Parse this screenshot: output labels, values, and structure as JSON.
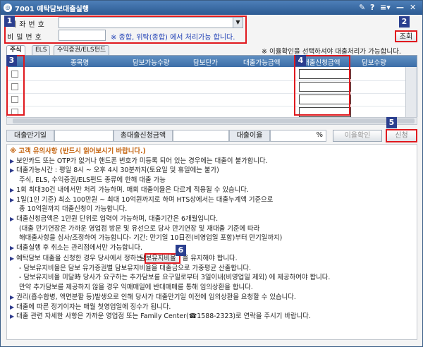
{
  "window": {
    "title": "7001 예탁담보대출실행",
    "controls": [
      "✎",
      "?",
      "≡▾",
      "—",
      "✕"
    ]
  },
  "annotations": [
    "1",
    "2",
    "3",
    "4",
    "5",
    "6"
  ],
  "form": {
    "account_label": "계좌번호",
    "password_label": "비밀번호",
    "password_note": "※ 종합, 위탁(종합) 에서 처리가능 합니다.",
    "query_button": "조회"
  },
  "tabs": [
    "주식",
    "ELS",
    "수익증권/ELS펀드"
  ],
  "tab_note": "※ 이율확인을 선택하셔야 대출처리가 가능합니다.",
  "grid": {
    "columns": [
      "종목명",
      "담보가능수량",
      "담보단가",
      "대출가능금액",
      "대출신청금액",
      "담보수량"
    ],
    "rows": 4
  },
  "summary": {
    "maturity_label": "대출만기일",
    "total_label": "총대출신청금액",
    "rate_label": "대출이율",
    "rate_unit": "%",
    "rate_check_button": "이율확인",
    "apply_button": "신청"
  },
  "notice": {
    "title": "※ 고객 유의사항 (반드시 읽어보시기 바랍니다.)",
    "lines": [
      {
        "b": true,
        "t": "보안카드 또는 OTP가 없거나 핸드폰 번호가 미등록 되어 있는 경우에는 대출이 불가합니다."
      },
      {
        "b": true,
        "t": "대출가능시간 : 평일 8시 ~ 오후 4시 30분까지(토요일 및 휴일에는 불가)"
      },
      {
        "b": false,
        "t": "주식, ELS, 수익증권/ELS펀드 종류에 한해 대출 가능"
      },
      {
        "b": true,
        "t": "1회 최대30건 내에서만 처리 가능하며. 매회 대출이율은 다르게 적용될 수 있습니다."
      },
      {
        "b": true,
        "t": "1일(1인 기준) 최소 100만원 ~ 최대 10억원까지로 하며 HTS상에서는 대출누계액 기준으로"
      },
      {
        "b": false,
        "t": "총 10억원까지 대출신청이 가능합니다."
      },
      {
        "b": true,
        "t": "대출신청금액은 1만원 단위로 입력이 가능하며, 대출기간은 6개월입니다."
      },
      {
        "b": false,
        "t": "(대출 만기연장은 가까운 영업점 방문 및 유선으로 당사 만기연장 및 재대출 기준에 따라"
      },
      {
        "b": false,
        "t": "해대출사항을 심사/조정하여 가능합니다- 기간: 만기일 10日전(비영업일 포함)부터 만기일까지)"
      },
      {
        "b": true,
        "t": "대출실행 후 취소는 관리점에서만 가능합니다."
      }
    ],
    "collateral_prefix": "예탁담보 대출을 신청한 경우 당사에서 정하는",
    "collateral_button": "담보유지비율",
    "collateral_suffix": "을 유지해야 합니다.",
    "lines2": [
      {
        "b": false,
        "t": "- 담보유지비율은 담보 유가증권별 담보유지비율을 대출금으로 가중평균 산출합니다."
      },
      {
        "b": false,
        "t": "- 담보유지비율 미달時 당사가 요구하는 추가담보를 요구일로부터 3일이내(비영업일 제외) 에 제공하여야 합니다."
      },
      {
        "b": false,
        "t": "만약 추가담보를 제공하지 않을 경우 익매매일에 반대매매를 통해 임의상환을 합니다."
      },
      {
        "b": true,
        "t": "권리(흡수합병, 액면분할 등)발생으로 인해 당사가 대출만기일 이전에 임의상환을 요청할 수 있습니다."
      },
      {
        "b": true,
        "t": "대출에 따른 정기이자는 매월 첫영업일에 징수가 됩니다."
      },
      {
        "b": true,
        "t": "대출 관련 자세한 사항은 가까운 영업점 또는 Family Center(☎1588-2323)로 연락을 주시기 바랍니다."
      }
    ]
  }
}
